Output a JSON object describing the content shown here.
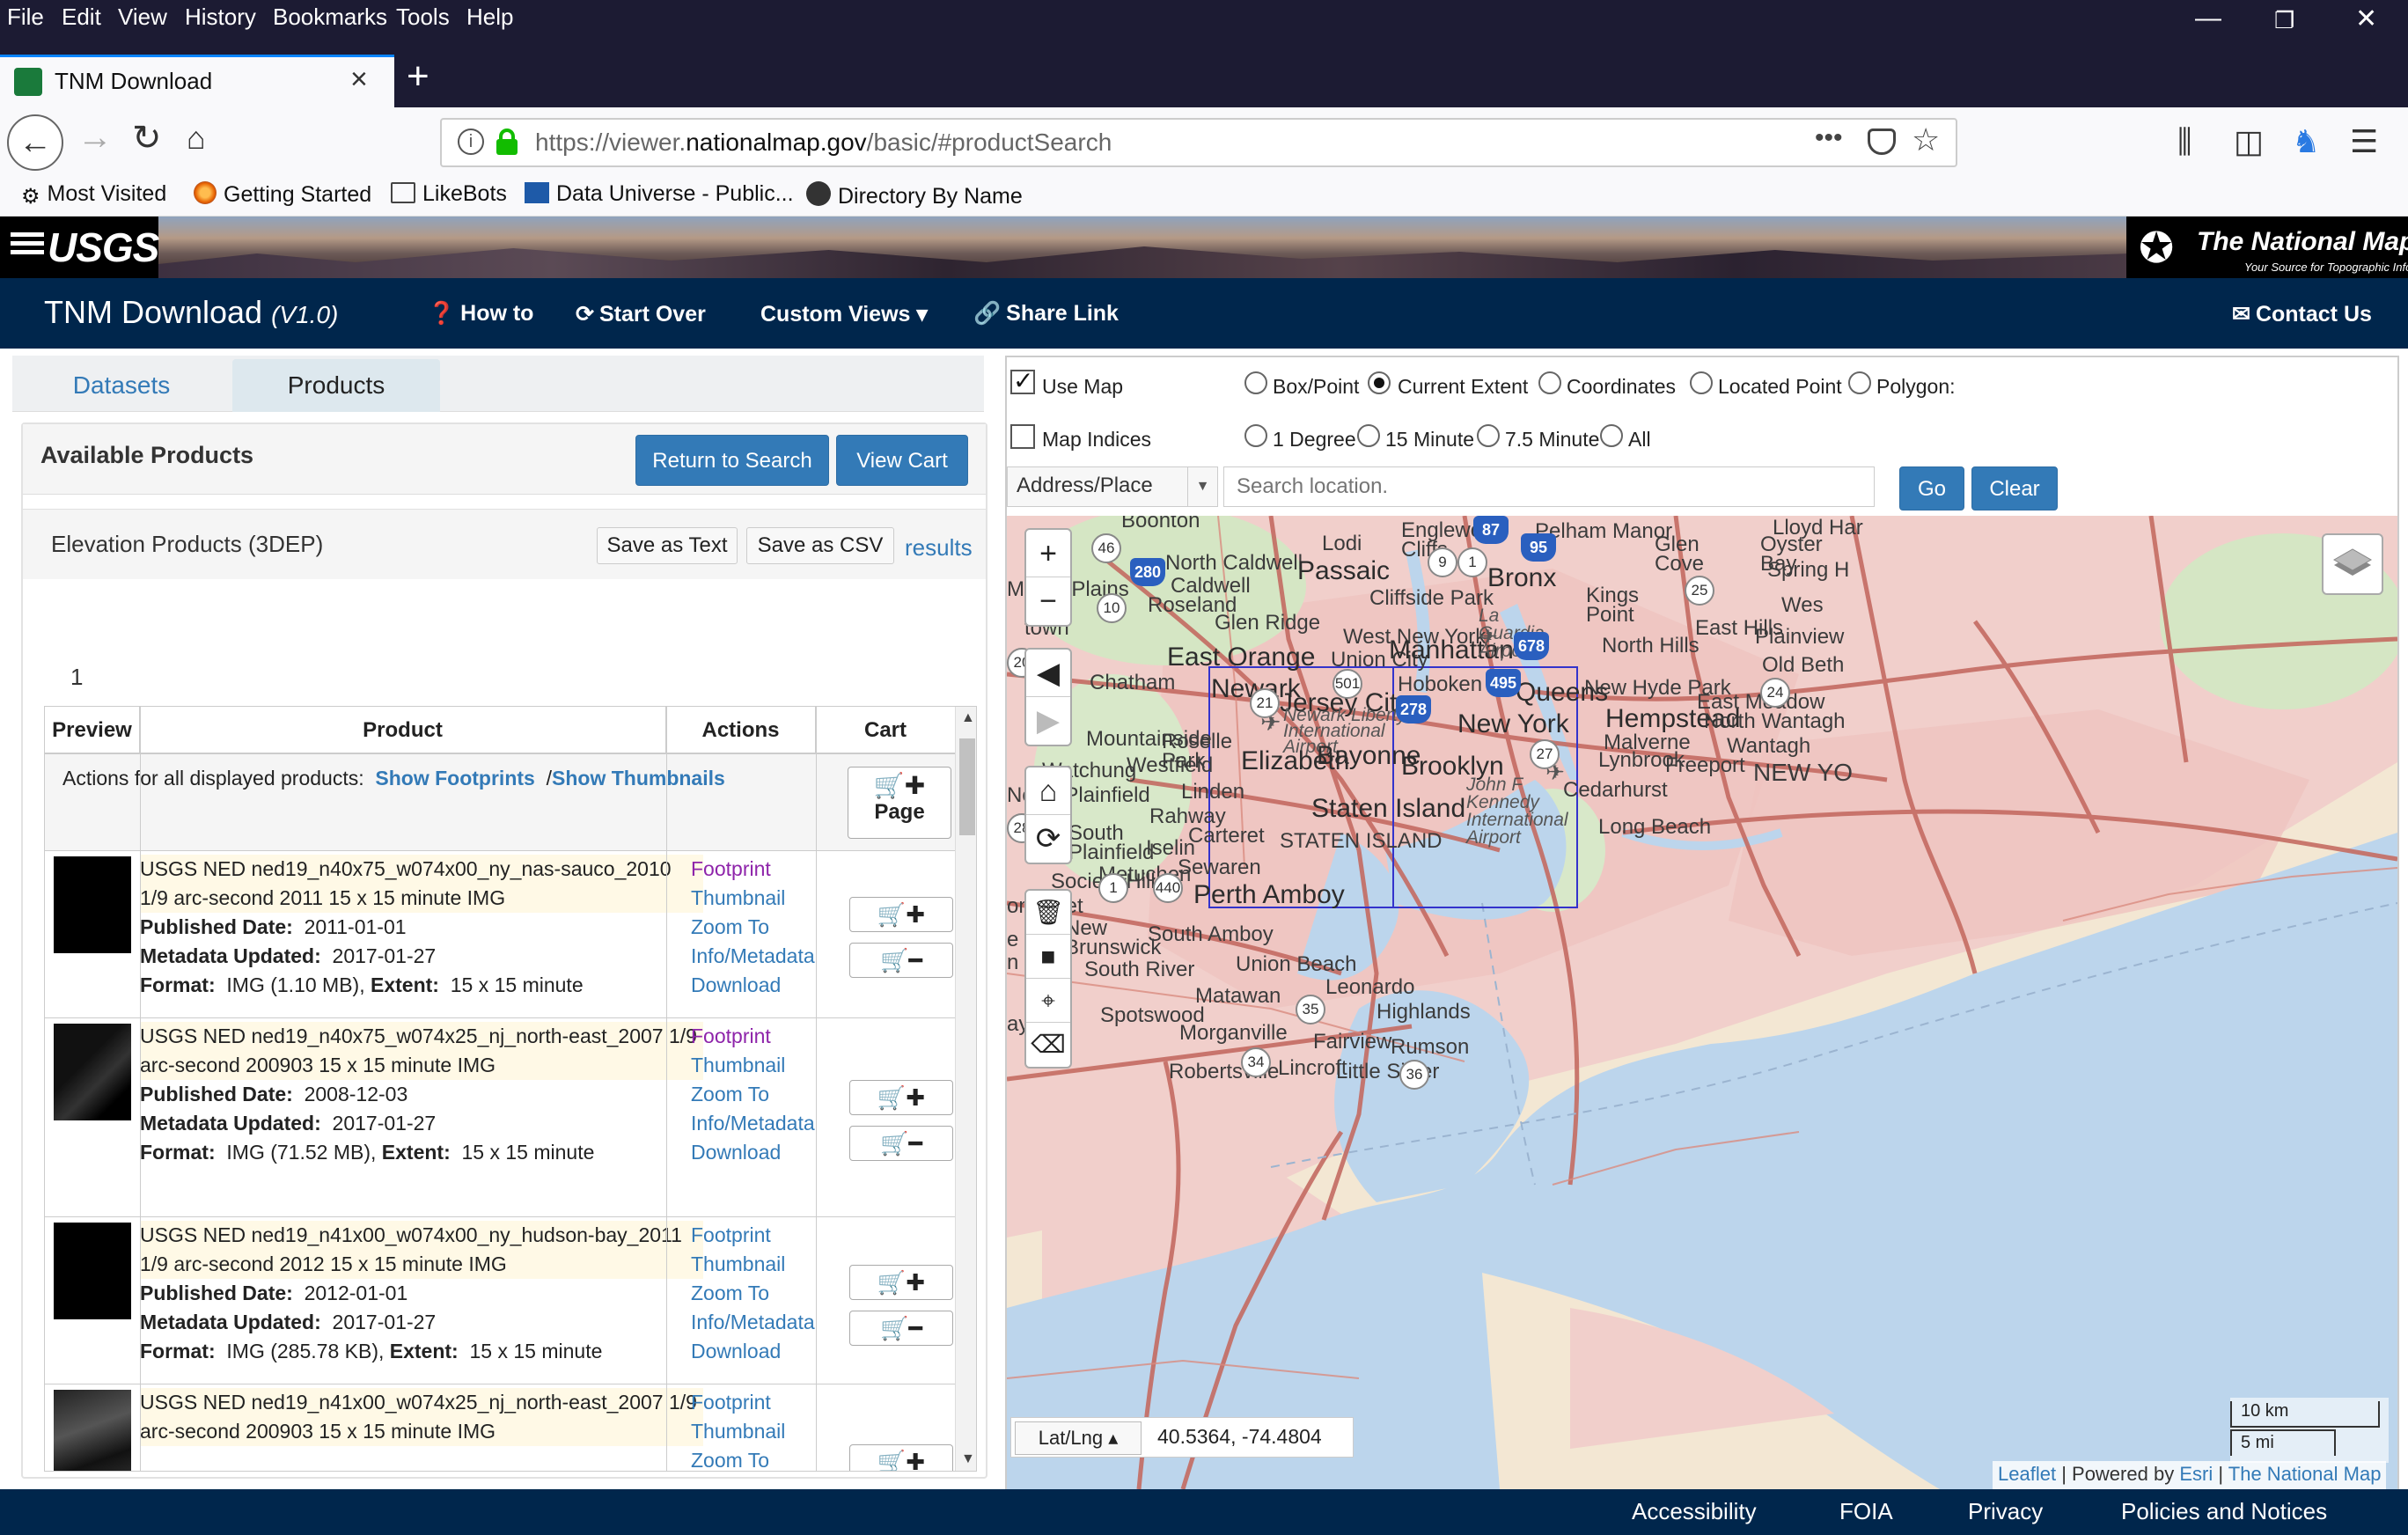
{
  "browser": {
    "menu": [
      "File",
      "Edit",
      "View",
      "History",
      "Bookmarks",
      "Tools",
      "Help"
    ],
    "tab_title": "TNM Download",
    "url_prefix": "https://viewer.",
    "url_domain": "nationalmap.gov",
    "url_path": "/basic/#productSearch",
    "bookmarks": [
      "Most Visited",
      "Getting Started",
      "LikeBots",
      "Data Universe - Public...",
      "Directory By Name"
    ]
  },
  "banner": {
    "usgs_logo": "USGS",
    "tnm_title": "The National Map",
    "tnm_tagline": "Your Source for Topographic Information"
  },
  "app": {
    "title": "TNM Download",
    "version": "(V1.0)",
    "nav": {
      "how_to": "How to",
      "start_over": "Start Over",
      "custom_views": "Custom Views",
      "share_link": "Share Link",
      "contact_us": "Contact Us"
    }
  },
  "left": {
    "tabs": [
      "Datasets",
      "Products"
    ],
    "available_title": "Available Products",
    "return_btn": "Return to Search",
    "cart_btn": "View Cart",
    "elevation_title": "Elevation Products (3DEP)",
    "save_text": "Save as Text",
    "save_csv": "Save as CSV",
    "results": "results",
    "page_number": "1",
    "headers": [
      "Preview",
      "Product",
      "Actions",
      "Cart"
    ],
    "all_actions_label": "Actions for all displayed products:",
    "show_footprints": "Show Footprints",
    "show_thumbnails": "Show Thumbnails",
    "sep": "/",
    "page_btn": "Page",
    "cart_add": "🛒✚",
    "cart_remove": "🛒━",
    "labels": {
      "published": "Published Date:",
      "metadata": "Metadata Updated:",
      "format": "Format:",
      "extent": "Extent:"
    },
    "actions": [
      "Footprint",
      "Thumbnail",
      "Zoom To",
      "Info/Metadata",
      "Download"
    ],
    "products": [
      {
        "title": "USGS NED ned19_n40x75_w074x00_ny_nas-sauco_2010 1/9 arc-second 2011 15 x 15 minute IMG",
        "published": "2011-01-01",
        "metadata": "2017-01-27",
        "format": "IMG (1.10 MB),",
        "extent": "15 x 15 minute"
      },
      {
        "title": "USGS NED ned19_n40x75_w074x25_nj_north-east_2007 1/9 arc-second 200903 15 x 15 minute IMG",
        "published": "2008-12-03",
        "metadata": "2017-01-27",
        "format": "IMG (71.52 MB),",
        "extent": "15 x 15 minute"
      },
      {
        "title": "USGS NED ned19_n41x00_w074x00_ny_hudson-bay_2011 1/9 arc-second 2012 15 x 15 minute IMG",
        "published": "2012-01-01",
        "metadata": "2017-01-27",
        "format": "IMG (285.78 KB),",
        "extent": "15 x 15 minute"
      },
      {
        "title": "USGS NED ned19_n41x00_w074x25_nj_north-east_2007 1/9 arc-second 200903 15 x 15 minute IMG"
      }
    ]
  },
  "map": {
    "use_map": "Use Map",
    "map_indices": "Map Indices",
    "extent_opts": [
      "Box/Point",
      "Current Extent",
      "Coordinates",
      "Located Point",
      "Polygon:"
    ],
    "index_opts": [
      "1 Degree",
      "15 Minute",
      "7.5 Minute",
      "All"
    ],
    "addr_type": "Address/Place",
    "search_placeholder": "Search location.",
    "go": "Go",
    "clear": "Clear",
    "latlng_label": "Lat/Lng ▴",
    "latlng_value": "40.5364, -74.4804",
    "scale_km": "10 km",
    "scale_mi": "5 mi",
    "attrib_leaflet": "Leaflet",
    "attrib_powered": "| Powered by",
    "attrib_esri": "Esri",
    "attrib_sep": "|",
    "attrib_tnm": "The National Map",
    "places": {
      "boonton": "Boonton",
      "north_caldwell": "North Caldwell",
      "caldwell": "Caldwell",
      "roseland": "Roseland",
      "morris_plains": "Morris Plains",
      "glen_ridge": "Glen Ridge",
      "east_orange": "East Orange",
      "chatham": "Chatham",
      "newark": "Newark",
      "jersey_city": "Jersey City",
      "newark_airport": "Newark Liberty International Airport",
      "elizabeth": "Elizabeth",
      "bayonne": "Bayonne",
      "hoboken": "Hoboken",
      "union_city": "Union City",
      "west_new_york": "West New York",
      "manhattan": "Manhattan",
      "passaic": "Passaic",
      "lodi": "Lodi",
      "englewood_cliffs": "Englewood Cliffs",
      "cliffside_park": "Cliffside Park",
      "pelham_manor": "Pelham Manor",
      "bronx": "Bronx",
      "la_guardia": "La Guardia Airport",
      "queens": "Queens",
      "new_york": "New York",
      "brooklyn": "Brooklyn",
      "jfk": "John F Kennedy International Airport",
      "kings_point": "Kings Point",
      "glen_cove": "Glen Cove",
      "oyster_bay": "Oyster Bay",
      "east_hills": "East Hills",
      "north_hills": "North Hills",
      "new_hyde_park": "New Hyde Park",
      "hempstead": "Hempstead",
      "east_meadow": "East Meadow",
      "north_wantagh": "North Wantagh",
      "malverne": "Malverne",
      "lynbrook": "Lynbrook",
      "wantagh": "Wantagh",
      "freeport": "Freeport",
      "cedarhurst": "Cedarhurst",
      "long_beach": "Long Beach",
      "mountainside": "Mountainside",
      "roselle_park": "Roselle Park",
      "westfield": "Westfield",
      "watchung": "Watchung",
      "north_plainfield": "North Plainfield",
      "linden": "Linden",
      "rahway": "Rahway",
      "carteret": "Carteret",
      "staten_island": "Staten Island",
      "staten_island_caps": "STATEN ISLAND",
      "south_plainfield": "South Plainfield",
      "iselin": "Iselin",
      "metuchen": "Metuchen",
      "sewaren": "Sewaren",
      "perth_amboy": "Perth Amboy",
      "south_amboy": "South Amboy",
      "new_brunswick": "New Brunswick",
      "south_river": "South River",
      "union_beach": "Union Beach",
      "leonardo": "Leonardo",
      "highlands": "Highlands",
      "matawan": "Matawan",
      "spotswood": "Spotswood",
      "morganville": "Morganville",
      "fairview": "Fairview",
      "rumson": "Rumson",
      "lincroft": "Lincroft",
      "little_silver": "Little Silver",
      "robertsville": "Robertsville",
      "somerset": "omerset",
      "run": "e Run",
      "park": "n Park",
      "dayton": "ayton",
      "society_hill": "Society Hill",
      "new_york_state": "NEW YO",
      "lloyd_harbor": "Lloyd Har",
      "spring": "Spring H",
      "plainview": "Plainview",
      "old_beth": "Old Beth",
      "west": "Wes",
      "town": "town"
    },
    "shields": {
      "i87": "87",
      "i95": "95",
      "i280": "280",
      "i495": "495",
      "i278": "278",
      "i678": "678",
      "us46": "46",
      "us1": "1",
      "r10": "10",
      "r9": "9",
      "r1b": "1",
      "r25": "25",
      "r24": "24",
      "r21": "21",
      "r501": "501",
      "r27": "27",
      "r28": "28",
      "r440": "440",
      "r35": "35",
      "r34": "34",
      "r36": "36",
      "r20": "20"
    }
  },
  "footer": [
    "Accessibility",
    "FOIA",
    "Privacy",
    "Policies and Notices"
  ],
  "colors": {
    "header": "#00264c",
    "button": "#337ab7",
    "chrome": "#1c1b33",
    "footprint": "#3333cc"
  }
}
